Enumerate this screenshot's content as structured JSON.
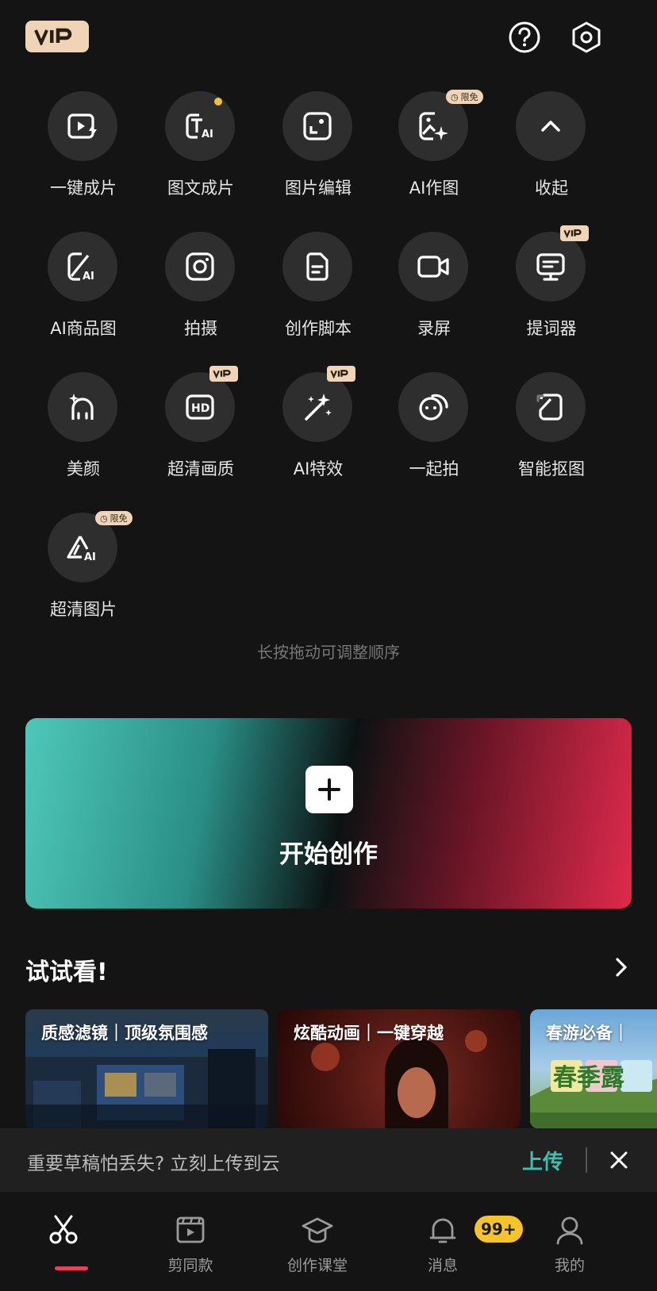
{
  "header": {
    "vip_logo_text": "VIP",
    "help_icon": "question-circle-icon",
    "settings_icon": "hexagon-settings-icon"
  },
  "tools": [
    {
      "label": "一键成片",
      "icon": "play-lightning-icon"
    },
    {
      "label": "图文成片",
      "icon": "text-ai-icon",
      "new_dot": true
    },
    {
      "label": "图片编辑",
      "icon": "image-edit-icon"
    },
    {
      "label": "AI作图",
      "icon": "ai-image-icon",
      "badge": "限免"
    },
    {
      "label": "收起",
      "icon": "chevron-up-icon"
    },
    {
      "label": "AI商品图",
      "icon": "ai-product-icon"
    },
    {
      "label": "拍摄",
      "icon": "camera-icon"
    },
    {
      "label": "创作脚本",
      "icon": "script-doc-icon"
    },
    {
      "label": "录屏",
      "icon": "screen-record-icon"
    },
    {
      "label": "提词器",
      "icon": "teleprompter-icon",
      "badge": "VIP"
    },
    {
      "label": "美颜",
      "icon": "beauty-face-icon"
    },
    {
      "label": "超清画质",
      "icon": "hd-icon",
      "badge": "VIP"
    },
    {
      "label": "AI特效",
      "icon": "magic-wand-icon",
      "badge": "VIP"
    },
    {
      "label": "一起拍",
      "icon": "together-shoot-icon"
    },
    {
      "label": "智能抠图",
      "icon": "cutout-icon"
    },
    {
      "label": "超清图片",
      "icon": "ai-enhance-icon",
      "badge": "限免"
    }
  ],
  "hint": "长按拖动可调整顺序",
  "create": {
    "label": "开始创作"
  },
  "try": {
    "title": "试试看!",
    "cards": [
      {
        "title": "质感滤镜｜顶级氛围感"
      },
      {
        "title": "炫酷动画｜一键穿越"
      },
      {
        "title": "春游必备｜"
      }
    ],
    "card3_art_text": "春季露"
  },
  "banner": {
    "text": "重要草稿怕丢失? 立刻上传到云",
    "upload_label": "上传"
  },
  "nav": {
    "items": [
      {
        "label": "",
        "icon": "scissors-icon"
      },
      {
        "label": "剪同款",
        "icon": "template-film-icon"
      },
      {
        "label": "创作课堂",
        "icon": "graduation-cap-icon"
      },
      {
        "label": "消息",
        "icon": "bell-icon"
      },
      {
        "label": "我的",
        "icon": "person-icon"
      }
    ],
    "message_badge": "99+"
  },
  "colors": {
    "background": "#141414",
    "accent_teal": "#3ac2b0",
    "accent_red": "#e8405a",
    "vip_gold": "#f0d4b8",
    "badge_yellow": "#f5c32a"
  }
}
